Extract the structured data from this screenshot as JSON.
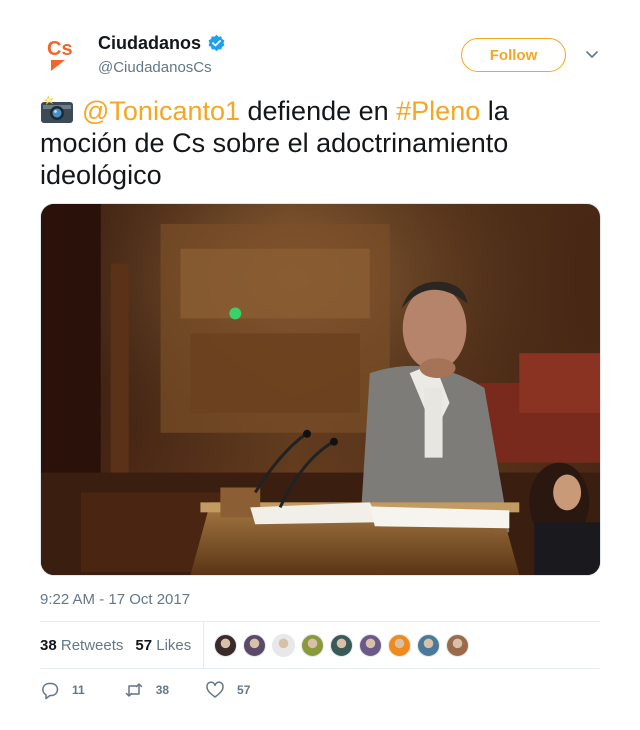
{
  "user": {
    "display_name": "Ciudadanos",
    "handle": "@CiudadanosCs",
    "logo_text": "Cs",
    "brand_color": "#f5a623",
    "verified": true
  },
  "header": {
    "follow_label": "Follow"
  },
  "tweet": {
    "text_parts": {
      "mention": "@Tonicanto1",
      "middle": " defiende en ",
      "hashtag": "#Pleno",
      "rest": " la moción de Cs sobre el adoctrinamiento ideológico"
    },
    "emoji": "camera-flash-icon",
    "media_description_icon": "photo-image",
    "timestamp": "9:22 AM - 17 Oct 2017"
  },
  "stats": {
    "retweets_count": "38",
    "retweets_label": "Retweets",
    "likes_count": "57",
    "likes_label": "Likes",
    "liker_avatars": [
      "#3a2a2a",
      "#5a4a6a",
      "#e8e8e8",
      "#8a9a3a",
      "#3a5a5a",
      "#6a5a8a",
      "#f08a1a",
      "#4a7a9a",
      "#9a6a4a"
    ]
  },
  "actions": {
    "reply_count": "11",
    "retweet_count": "38",
    "like_count": "57"
  },
  "colors": {
    "accent": "#f5a623",
    "text": "#14171a",
    "muted": "#657786",
    "border": "#e6ecf0"
  }
}
